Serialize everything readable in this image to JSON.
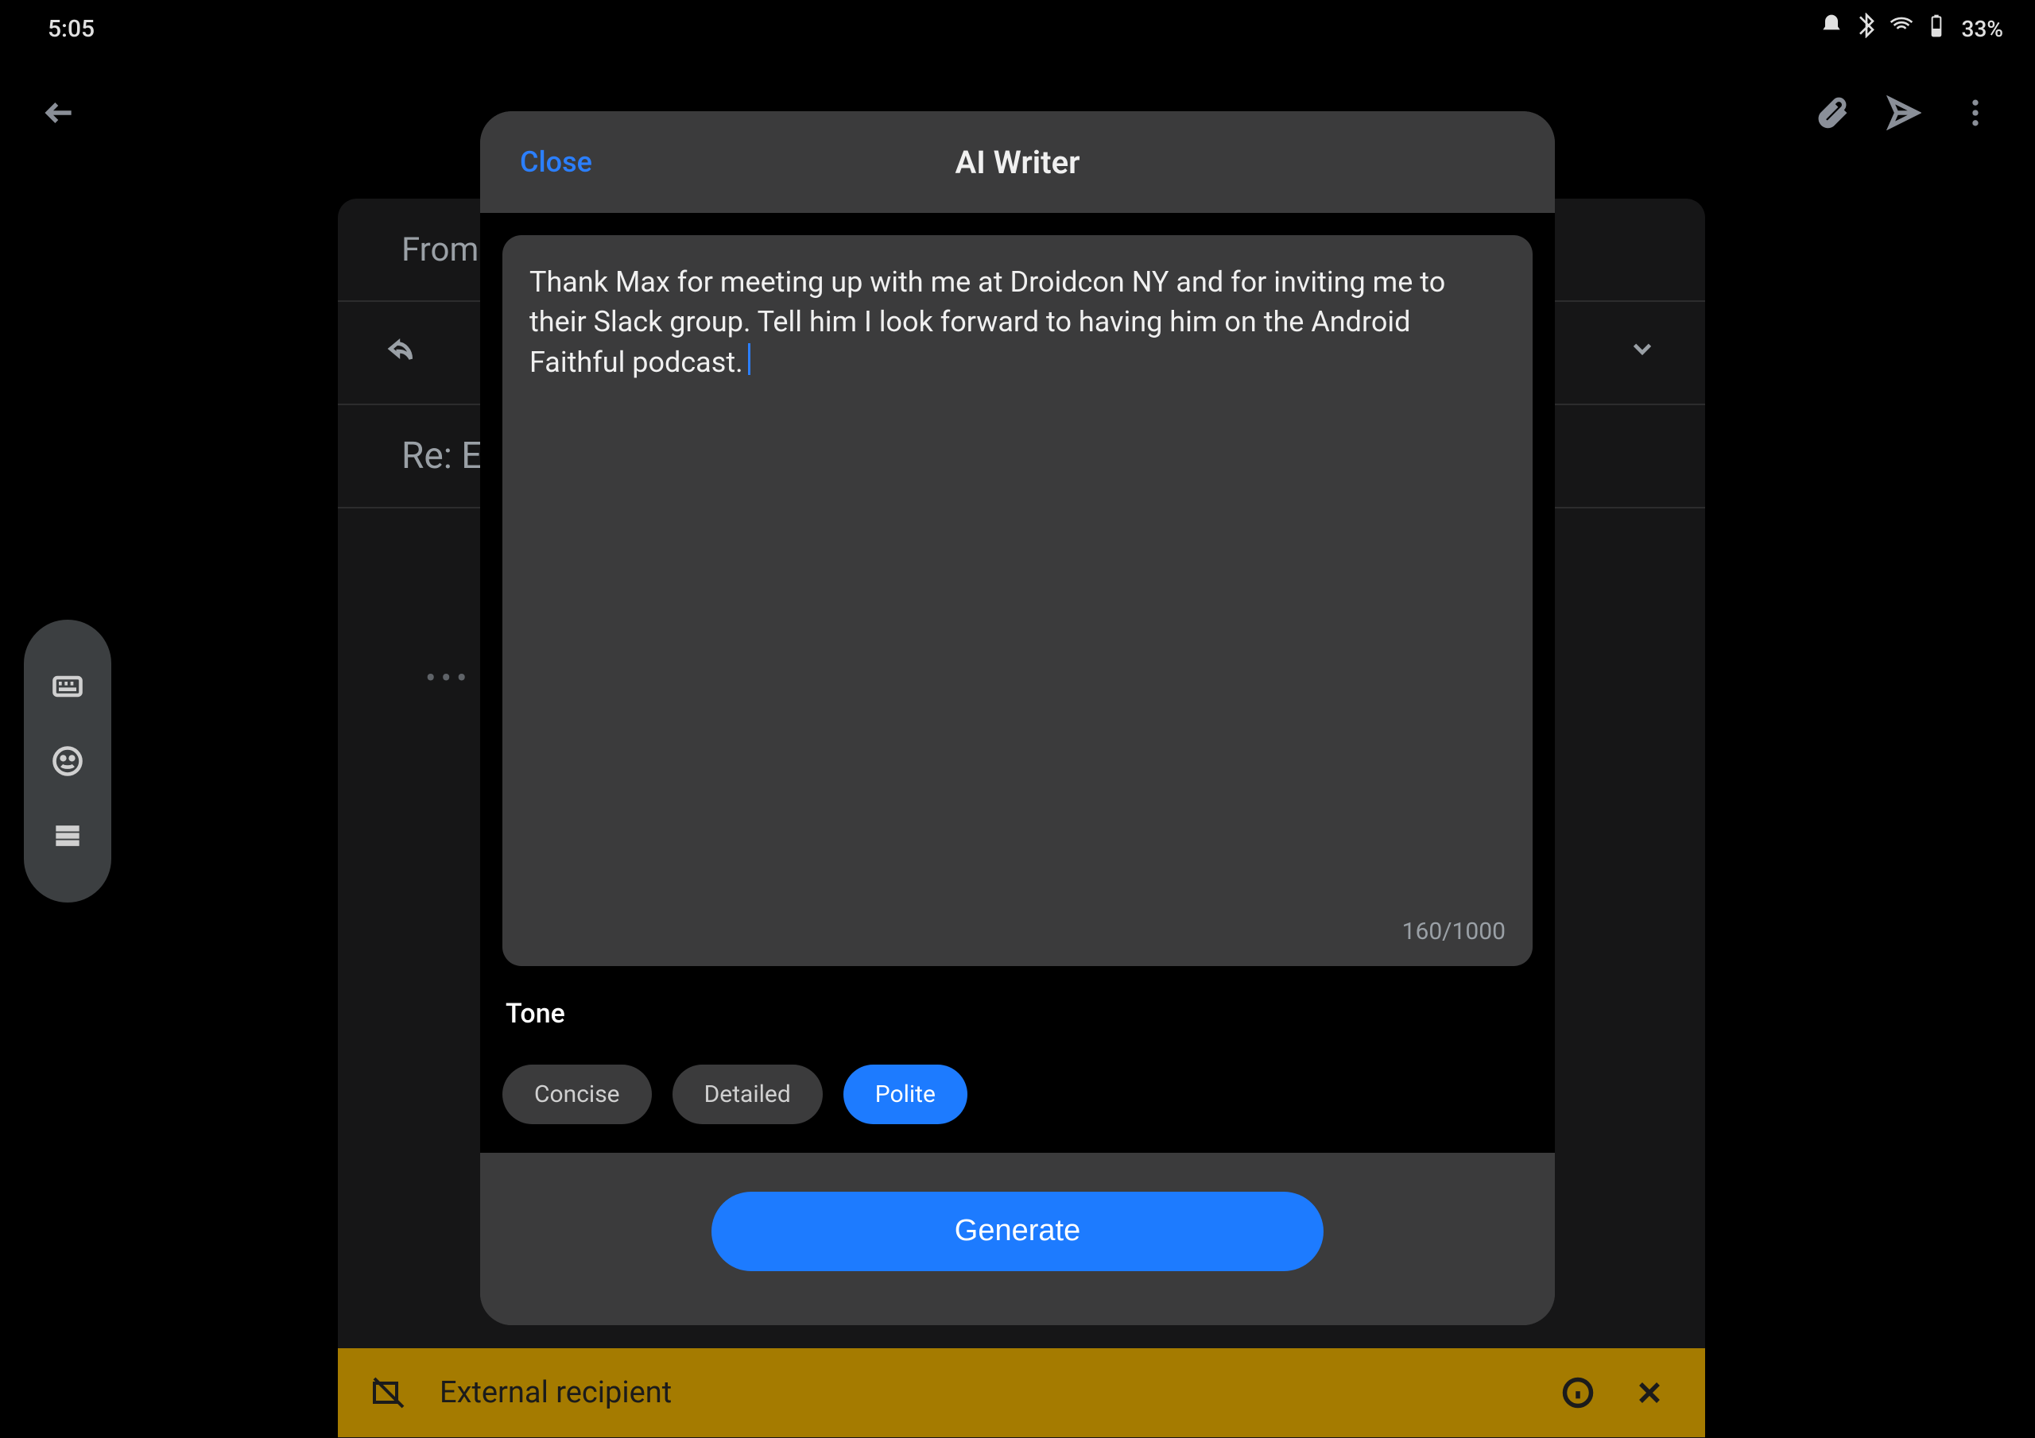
{
  "status_bar": {
    "time": "5:05",
    "battery_text": "33%"
  },
  "compose": {
    "from_label": "From",
    "subject": "Re: E"
  },
  "ai_writer": {
    "close_label": "Close",
    "title": "AI Writer",
    "prompt_text": "Thank Max for meeting up with me at Droidcon NY and for inviting me to their Slack group. Tell him I look forward to having him on the Android Faithful podcast.",
    "char_count": "160/1000",
    "tone_label": "Tone",
    "tone_options": [
      "Concise",
      "Detailed",
      "Polite"
    ],
    "tone_selected_index": 2,
    "generate_label": "Generate"
  },
  "external_bar": {
    "text": "External recipient"
  }
}
